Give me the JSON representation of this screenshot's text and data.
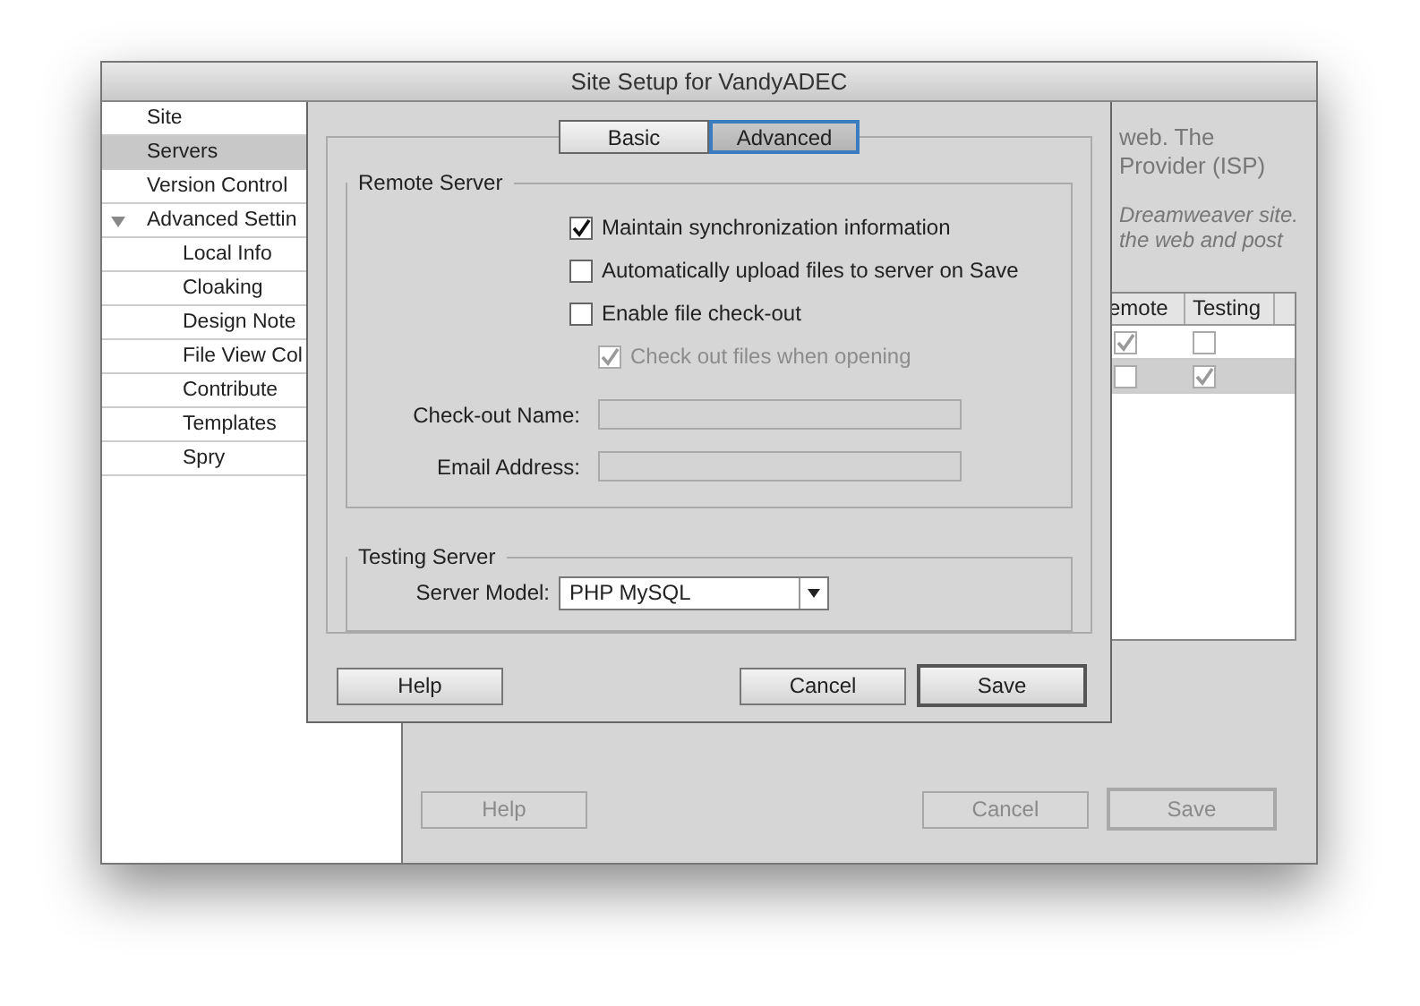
{
  "window": {
    "title": "Site Setup for VandyADEC"
  },
  "sidebar": {
    "items": [
      {
        "label": "Site",
        "selected": false
      },
      {
        "label": "Servers",
        "selected": true
      },
      {
        "label": "Version Control",
        "selected": false
      },
      {
        "label": "Advanced Settin",
        "selected": false,
        "expanded": true,
        "children": [
          {
            "label": "Local Info",
            "selected": false
          },
          {
            "label": "Cloaking",
            "selected": false
          },
          {
            "label": "Design Note",
            "selected": false
          },
          {
            "label": "File View Col",
            "selected": false
          },
          {
            "label": "Contribute",
            "selected": false
          },
          {
            "label": "Templates",
            "selected": false
          },
          {
            "label": "Spry",
            "selected": false
          }
        ]
      }
    ]
  },
  "background_panel": {
    "description_lines": [
      "web. The",
      "Provider (ISP)"
    ],
    "note_lines": [
      "Dreamweaver site.",
      "the web and post"
    ],
    "table": {
      "columns": [
        "emote",
        "Testing"
      ],
      "rows": [
        {
          "selected": false,
          "remote": true,
          "testing": false
        },
        {
          "selected": true,
          "remote": false,
          "testing": true
        }
      ]
    },
    "buttons": [
      {
        "label": "Help",
        "disabled": true,
        "default": false
      },
      {
        "label": "Cancel",
        "disabled": true,
        "default": false
      },
      {
        "label": "Save",
        "disabled": true,
        "default": true
      }
    ]
  },
  "dialog": {
    "tabs": [
      {
        "label": "Basic",
        "selected": false
      },
      {
        "label": "Advanced",
        "selected": true
      }
    ],
    "remote_server": {
      "title": "Remote Server",
      "options": [
        {
          "label": "Maintain synchronization information",
          "checked": true,
          "disabled": false,
          "indented": false
        },
        {
          "label": "Automatically upload files to server on Save",
          "checked": false,
          "disabled": false,
          "indented": false
        },
        {
          "label": "Enable file check-out",
          "checked": false,
          "disabled": false,
          "indented": false
        },
        {
          "label": "Check out files when opening",
          "checked": true,
          "disabled": true,
          "indented": true
        }
      ],
      "fields": [
        {
          "label": "Check-out Name:",
          "disabled": true
        },
        {
          "label": "Email Address:",
          "disabled": true
        }
      ]
    },
    "testing_server": {
      "title": "Testing Server",
      "server_model": {
        "label": "Server Model:",
        "value": "PHP MySQL"
      }
    },
    "buttons": [
      {
        "label": "Help",
        "disabled": false,
        "default": false
      },
      {
        "label": "Cancel",
        "disabled": false,
        "default": false
      },
      {
        "label": "Save",
        "disabled": false,
        "default": true
      }
    ]
  }
}
